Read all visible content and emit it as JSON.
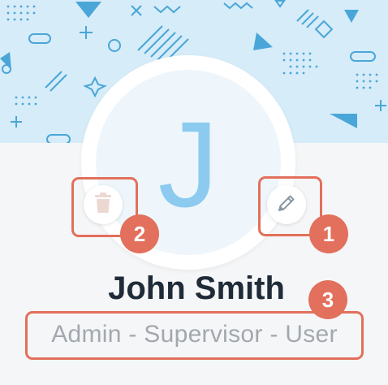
{
  "profile": {
    "initial": "J",
    "name": "John Smith",
    "roles": "Admin - Supervisor - User"
  },
  "actions": {
    "delete_icon": "trash-icon",
    "edit_icon": "pencil-icon"
  },
  "annotations": {
    "edit": "1",
    "delete": "2",
    "roles": "3"
  },
  "colors": {
    "banner": "#d6ecf8",
    "pattern": "#4aa6d8",
    "avatar_initial": "#8ccbef",
    "annotation": "#e2705c",
    "name": "#1f2b37",
    "roles": "#a3a8ae"
  }
}
